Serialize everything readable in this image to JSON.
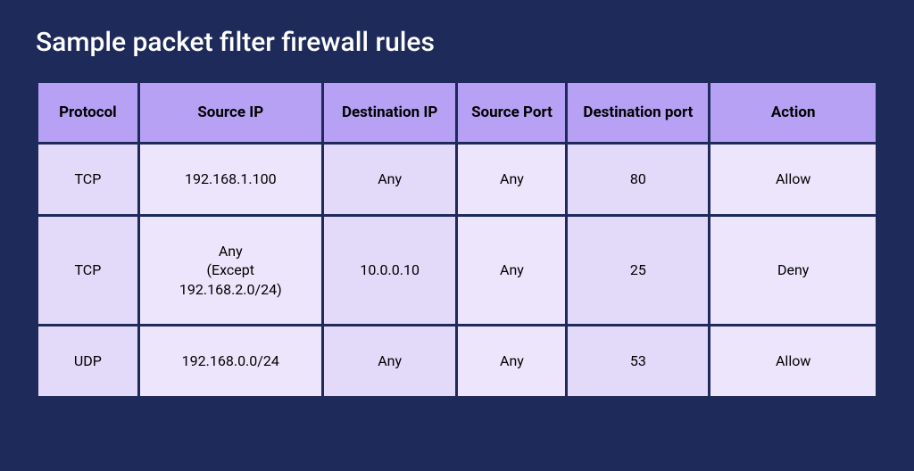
{
  "title": "Sample packet filter firewall rules",
  "headers": {
    "protocol": "Protocol",
    "source_ip": "Source IP",
    "dest_ip": "Destination IP",
    "source_port": "Source Port",
    "dest_port": "Destination port",
    "action": "Action"
  },
  "rows": [
    {
      "protocol": "TCP",
      "source_ip": "192.168.1.100",
      "dest_ip": "Any",
      "source_port": "Any",
      "dest_port": "80",
      "action": "Allow"
    },
    {
      "protocol": "TCP",
      "source_ip": "Any\n(Except\n192.168.2.0/24)",
      "dest_ip": "10.0.0.10",
      "source_port": "Any",
      "dest_port": "25",
      "action": "Deny"
    },
    {
      "protocol": "UDP",
      "source_ip": "192.168.0.0/24",
      "dest_ip": "Any",
      "source_port": "Any",
      "dest_port": "53",
      "action": "Allow"
    }
  ],
  "chart_data": {
    "type": "table",
    "title": "Sample packet filter firewall rules",
    "columns": [
      "Protocol",
      "Source IP",
      "Destination IP",
      "Source Port",
      "Destination port",
      "Action"
    ],
    "rows": [
      [
        "TCP",
        "192.168.1.100",
        "Any",
        "Any",
        "80",
        "Allow"
      ],
      [
        "TCP",
        "Any (Except 192.168.2.0/24)",
        "10.0.0.10",
        "Any",
        "25",
        "Deny"
      ],
      [
        "UDP",
        "192.168.0.0/24",
        "Any",
        "Any",
        "53",
        "Allow"
      ]
    ]
  }
}
